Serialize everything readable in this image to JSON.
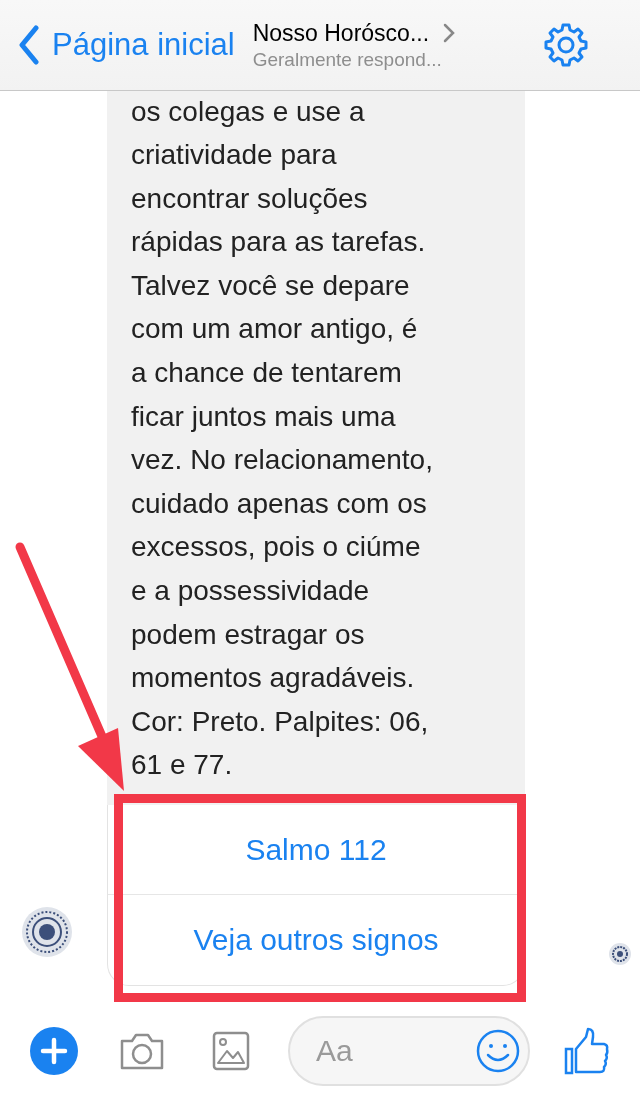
{
  "header": {
    "back_label": "Página inicial",
    "title": "Nosso Horósco...",
    "subtitle": "Geralmente respond..."
  },
  "message": {
    "text": "os colegas e use a\ncriatividade para\nencontrar soluções\nrápidas para as tarefas.\nTalvez você se depare\ncom um amor antigo, é\na chance de tentarem\nficar juntos mais uma\nvez. No relacionamento,\ncuidado apenas com os\nexcessos, pois o ciúme\ne a possessividade\npodem estragar os\nmomentos agradáveis.\nCor: Preto. Palpites: 06,\n61 e 77."
  },
  "quick_replies": [
    "Salmo 112",
    "Veja outros signos"
  ],
  "composer": {
    "placeholder": "Aa"
  }
}
